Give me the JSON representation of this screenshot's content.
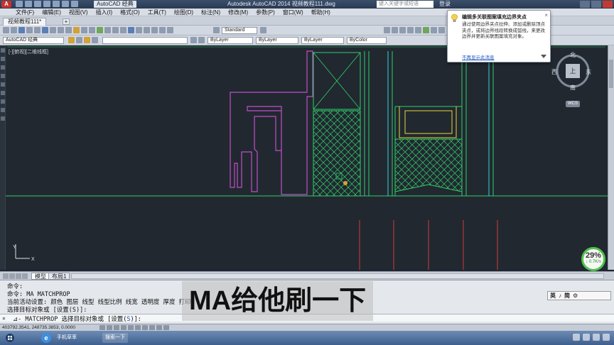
{
  "titlebar": {
    "app_button": "A",
    "workspace": "AutoCAD 经典",
    "title": "Autodesk AutoCAD 2014    视频教程111.dwg",
    "search_placeholder": "键入关键字或短语",
    "login": "登录"
  },
  "menu": [
    "文件(F)",
    "编辑(E)",
    "视图(V)",
    "插入(I)",
    "格式(O)",
    "工具(T)",
    "绘图(D)",
    "标注(N)",
    "修改(M)",
    "参数(P)",
    "窗口(W)",
    "帮助(H)"
  ],
  "tabs": {
    "doc_tab": "视频教程111*",
    "plus": "+"
  },
  "toolbar": {
    "workspace_combo": "AutoCAD 经典",
    "layer_combo": "ByLayer",
    "linetype_combo": "ByLayer",
    "lineweight_combo": "ByLayer",
    "color_combo": "ByColor",
    "style_combo": "Standard"
  },
  "viewport": {
    "label": "[-][俯视][二维线框]"
  },
  "viewcube": {
    "north": "北",
    "south": "南",
    "east": "东",
    "west": "西",
    "top": "上",
    "wcs": "WCS"
  },
  "zoom_indicator": {
    "percent": "29%",
    "speed": "↓ 0.7K/s"
  },
  "layout_tabs": [
    "模型",
    "布局1"
  ],
  "command": {
    "line1": "命令:",
    "line2": "命令: MA MATCHPROP",
    "line3": "当前活动设置:  颜色 图层 线型 线型比例 线宽 透明度 厚度 打印",
    "line4": "选择目标对象或 [设置(S)]:",
    "prompt_x": "✕",
    "prompt_text": "⊿- MATCHPROP 选择目标对象或 [设置(",
    "prompt_sel": "S",
    "prompt_end": ")]:"
  },
  "subtitle": "MA给他刷一下",
  "ime": [
    "英",
    "♪",
    "简",
    "⚙"
  ],
  "status": {
    "coords": "403792.3541, 248735.3853, 0.0000"
  },
  "taskbar": {
    "task1": "手机草率",
    "task2": "搜索一下"
  },
  "balloon": {
    "title": "编辑多关联图案填充边界夹点",
    "body": "通过使用边界夹点拉伸、添加或删除顶点夹点，或将边界线段转换成弧线，来更改边界并更新关联图案填充对象。",
    "link": "不再显示此消息",
    "close": "×"
  },
  "colors": {
    "canvas_bg": "#212830",
    "green": "#2fd06a",
    "magenta": "#c14fc8",
    "cyan": "#33d4d8",
    "red": "#d23a3a",
    "yellow": "#e6d63c"
  }
}
